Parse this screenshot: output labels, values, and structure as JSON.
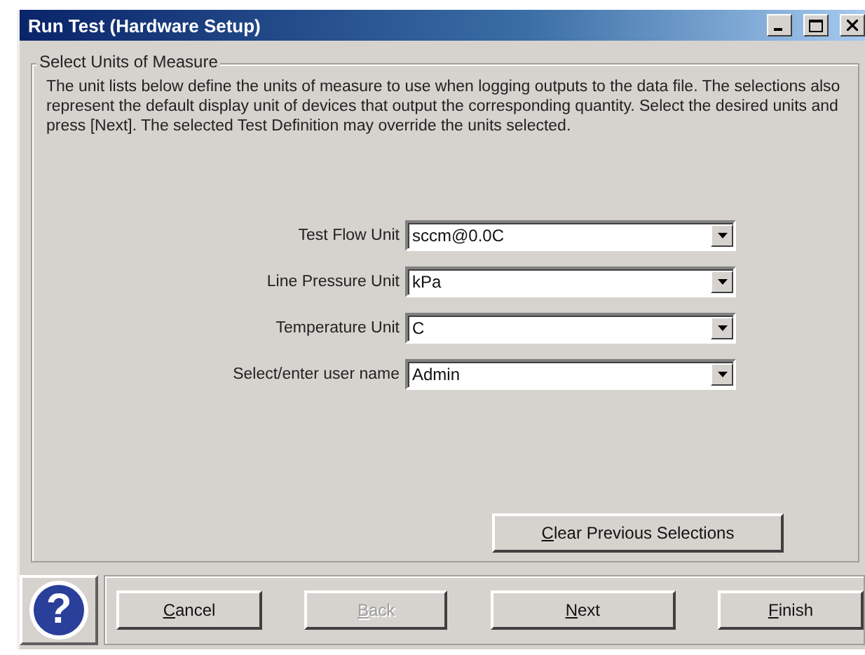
{
  "window": {
    "title": "Run Test (Hardware Setup)"
  },
  "group": {
    "title": "Select Units of Measure",
    "description": "The unit lists below define the units of measure to use when logging outputs to the data file. The selections also represent the default display unit of devices that output the corresponding quantity.  Select the desired units and press [Next].   The selected Test Definition may override the units selected."
  },
  "fields": [
    {
      "label": "Test Flow Unit",
      "value": "sccm@0.0C"
    },
    {
      "label": "Line Pressure Unit",
      "value": "kPa"
    },
    {
      "label": "Temperature Unit",
      "value": "C"
    },
    {
      "label": "Select/enter user name",
      "value": "Admin"
    }
  ],
  "clear_button": "Clear Previous Selections",
  "help_button": "?",
  "buttons": [
    {
      "label": "Cancel",
      "disabled": false
    },
    {
      "label": "Back",
      "disabled": true
    },
    {
      "label": "Next",
      "disabled": false
    },
    {
      "label": "Finish",
      "disabled": false
    }
  ]
}
